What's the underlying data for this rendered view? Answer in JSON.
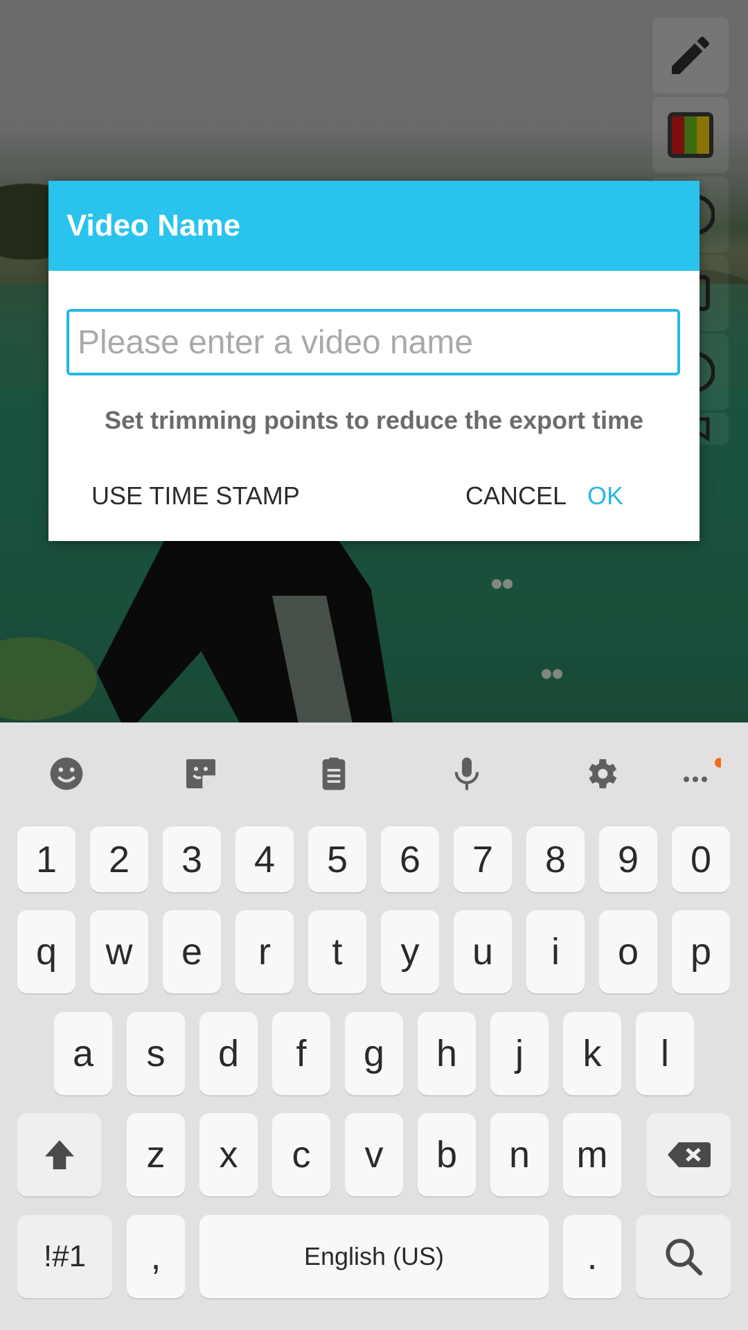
{
  "dialog": {
    "title": "Video Name",
    "input_placeholder": "Please enter a video name",
    "input_value": "",
    "hint": "Set trimming points to reduce the export time",
    "buttons": {
      "timestamp": "USE TIME STAMP",
      "cancel": "CANCEL",
      "ok": "OK"
    }
  },
  "colors": {
    "accent": "#29c3ee",
    "ok_text": "#2cb5e6",
    "keyboard_bg": "#e1e1e1",
    "key_bg": "#f8f8f8",
    "notification_dot": "#f26b1d"
  },
  "tool_column": [
    "pencil-icon",
    "color-palette-icon",
    "circle-tool-icon",
    "clock-tool-icon",
    "circle-tool-icon",
    "line-tool-icon"
  ],
  "keyboard": {
    "toolbar": [
      "emoji-icon",
      "sticker-icon",
      "clipboard-icon",
      "microphone-icon",
      "settings-icon",
      "more-icon"
    ],
    "rows": {
      "numbers": [
        "1",
        "2",
        "3",
        "4",
        "5",
        "6",
        "7",
        "8",
        "9",
        "0"
      ],
      "row1": [
        "q",
        "w",
        "e",
        "r",
        "t",
        "y",
        "u",
        "i",
        "o",
        "p"
      ],
      "row2": [
        "a",
        "s",
        "d",
        "f",
        "g",
        "h",
        "j",
        "k",
        "l"
      ],
      "row3": [
        "z",
        "x",
        "c",
        "v",
        "b",
        "n",
        "m"
      ]
    },
    "symbols_label": "!#1",
    "comma": ",",
    "space_label": "English (US)",
    "period": "."
  }
}
